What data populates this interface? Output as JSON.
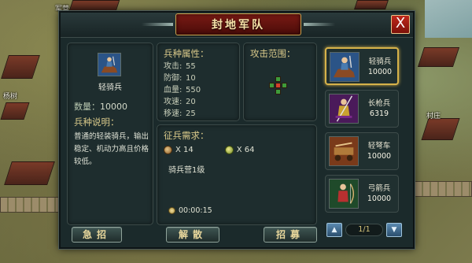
{
  "map": {
    "labels": [
      "军营",
      "杨树",
      "村庄"
    ]
  },
  "panel": {
    "title": "封地军队",
    "close_label": "X"
  },
  "unit": {
    "name": "轻骑兵",
    "count_label": "数量：",
    "count_value": "10000",
    "desc_heading": "兵种说明：",
    "desc_text": "普通的轻装骑兵，输出稳定、机动力高且价格较低。"
  },
  "attributes": {
    "heading": "兵种属性：",
    "rows": [
      {
        "label": "攻击:",
        "value": "55"
      },
      {
        "label": "防御:",
        "value": "10"
      },
      {
        "label": "血量:",
        "value": "550"
      },
      {
        "label": "攻速:",
        "value": "20"
      },
      {
        "label": "移速:",
        "value": "25"
      }
    ]
  },
  "range": {
    "heading": "攻击范围："
  },
  "recruit": {
    "heading": "征兵需求：",
    "wood_amount": "X 14",
    "food_amount": "X 64",
    "building_req": "骑兵营1级",
    "time": "00:00:15"
  },
  "buttons": {
    "urgent": "急招",
    "disband": "解散",
    "recruit": "招募"
  },
  "unit_list": [
    {
      "name": "轻骑兵",
      "count": "10000",
      "selected": true
    },
    {
      "name": "长枪兵",
      "count": "6319",
      "selected": false
    },
    {
      "name": "轻弩车",
      "count": "10000",
      "selected": false
    },
    {
      "name": "弓箭兵",
      "count": "10000",
      "selected": false
    }
  ],
  "pager": {
    "label": "1/1"
  }
}
